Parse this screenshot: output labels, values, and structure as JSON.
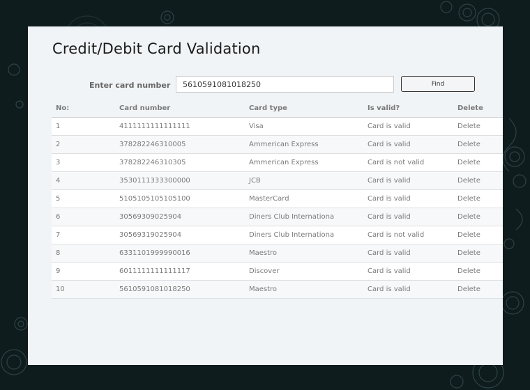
{
  "page": {
    "title": "Credit/Debit Card Validation"
  },
  "search": {
    "label": "Enter card number",
    "value": "5610591081018250",
    "button_label": "Find"
  },
  "table": {
    "headers": {
      "no": "No:",
      "card_number": "Card number",
      "card_type": "Card type",
      "is_valid": "Is valid?",
      "delete": "Delete"
    },
    "rows": [
      {
        "no": "1",
        "card_number": "4111111111111111",
        "card_type": "Visa",
        "is_valid": "Card is valid",
        "delete": "Delete"
      },
      {
        "no": "2",
        "card_number": "378282246310005",
        "card_type": "Ammerican Express",
        "is_valid": "Card is valid",
        "delete": "Delete"
      },
      {
        "no": "3",
        "card_number": "378282246310305",
        "card_type": "Ammerican Express",
        "is_valid": "Card is not valid",
        "delete": "Delete"
      },
      {
        "no": "4",
        "card_number": "3530111333300000",
        "card_type": "JCB",
        "is_valid": "Card is valid",
        "delete": "Delete"
      },
      {
        "no": "5",
        "card_number": "5105105105105100",
        "card_type": "MasterCard",
        "is_valid": "Card is valid",
        "delete": "Delete"
      },
      {
        "no": "6",
        "card_number": "30569309025904",
        "card_type": "Diners Club Internationa",
        "is_valid": "Card is valid",
        "delete": "Delete"
      },
      {
        "no": "7",
        "card_number": "30569319025904",
        "card_type": "Diners Club Internationa",
        "is_valid": "Card is not valid",
        "delete": "Delete"
      },
      {
        "no": "8",
        "card_number": "6331101999990016",
        "card_type": "Maestro",
        "is_valid": "Card is valid",
        "delete": "Delete"
      },
      {
        "no": "9",
        "card_number": "6011111111111117",
        "card_type": "Discover",
        "is_valid": "Card is valid",
        "delete": "Delete"
      },
      {
        "no": "10",
        "card_number": "5610591081018250",
        "card_type": "Maestro",
        "is_valid": "Card is valid",
        "delete": "Delete"
      }
    ]
  },
  "colors": {
    "background": "#0f1c1e",
    "panel": "#f1f4f7",
    "ornament": "#2c4246"
  }
}
